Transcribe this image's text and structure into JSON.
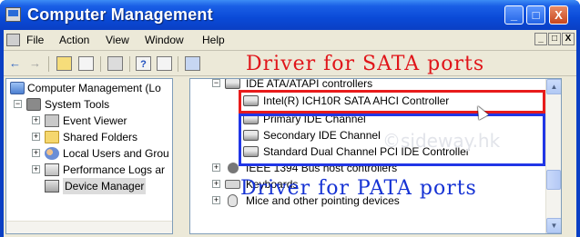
{
  "window": {
    "title": "Computer Management",
    "controls": {
      "minimize": "_",
      "maximize": "□",
      "close": "X"
    }
  },
  "menubar": {
    "items": [
      "File",
      "Action",
      "View",
      "Window",
      "Help"
    ],
    "mdi_controls": [
      "_",
      "□",
      "X"
    ]
  },
  "toolbar": {
    "buttons": [
      "back-icon",
      "forward-icon",
      "up-folder-icon",
      "show-hide-tree-icon",
      "print-icon",
      "help-icon",
      "properties-icon",
      "scan-hardware-icon"
    ]
  },
  "tree": {
    "items": [
      {
        "label": "Computer Management (Lo",
        "icon": "computer-icon",
        "expander": "−"
      },
      {
        "label": "System Tools",
        "icon": "tools-icon",
        "expander": "−"
      },
      {
        "label": "Event Viewer",
        "icon": "event-viewer-icon",
        "expander": "+"
      },
      {
        "label": "Shared Folders",
        "icon": "shared-folder-icon",
        "expander": "+"
      },
      {
        "label": "Local Users and Grou",
        "icon": "users-icon",
        "expander": "+"
      },
      {
        "label": "Performance Logs ar",
        "icon": "performance-icon",
        "expander": "+"
      },
      {
        "label": "Device Manager",
        "icon": "device-manager-icon",
        "expander": ""
      }
    ]
  },
  "devices": {
    "category_ide": "IDE ATA/ATAPI controllers",
    "ide_children": [
      "Intel(R) ICH10R SATA AHCI Controller",
      "Primary IDE Channel",
      "Secondary IDE Channel",
      "Standard Dual Channel PCI IDE Controller"
    ],
    "category_1394": "IEEE 1394 Bus host controllers",
    "category_keyboards": "Keyboards",
    "category_mice": "Mice and other pointing devices"
  },
  "annotations": {
    "sata": "Driver for SATA ports",
    "pata": "Driver for PATA ports",
    "watermark": "©sideway.hk",
    "sata_color": "#e81b1b",
    "pata_color": "#2136e6"
  }
}
